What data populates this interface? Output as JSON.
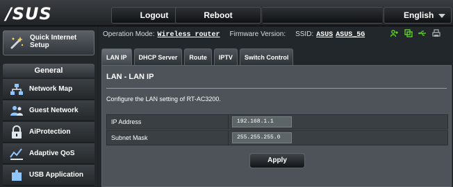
{
  "header": {
    "logo": "/SUS",
    "logout_label": "Logout",
    "reboot_label": "Reboot",
    "language": "English"
  },
  "sidebar": {
    "quick_setup": "Quick Internet Setup",
    "section_title": "General",
    "items": [
      {
        "label": "Network Map"
      },
      {
        "label": "Guest Network"
      },
      {
        "label": "AiProtection"
      },
      {
        "label": "Adaptive QoS"
      },
      {
        "label": "USB Application"
      }
    ]
  },
  "status": {
    "op_mode_label": "Operation Mode:",
    "op_mode_value": "Wireless router",
    "firmware_label": "Firmware Version:",
    "ssid_label": "SSID:",
    "ssid_1": "ASUS",
    "ssid_2": "ASUS_5G"
  },
  "tabs": [
    "LAN IP",
    "DHCP Server",
    "Route",
    "IPTV",
    "Switch Control"
  ],
  "panel": {
    "title": "LAN - LAN IP",
    "description": "Configure the LAN setting of RT-AC3200.",
    "fields": [
      {
        "label": "IP Address",
        "value": "192.168.1.1"
      },
      {
        "label": "Subnet Mask",
        "value": "255.255.255.0"
      }
    ],
    "apply_label": "Apply"
  },
  "colors": {
    "status_icon_green": "#5fd21e",
    "accent_rule": "#7ea6b8"
  }
}
